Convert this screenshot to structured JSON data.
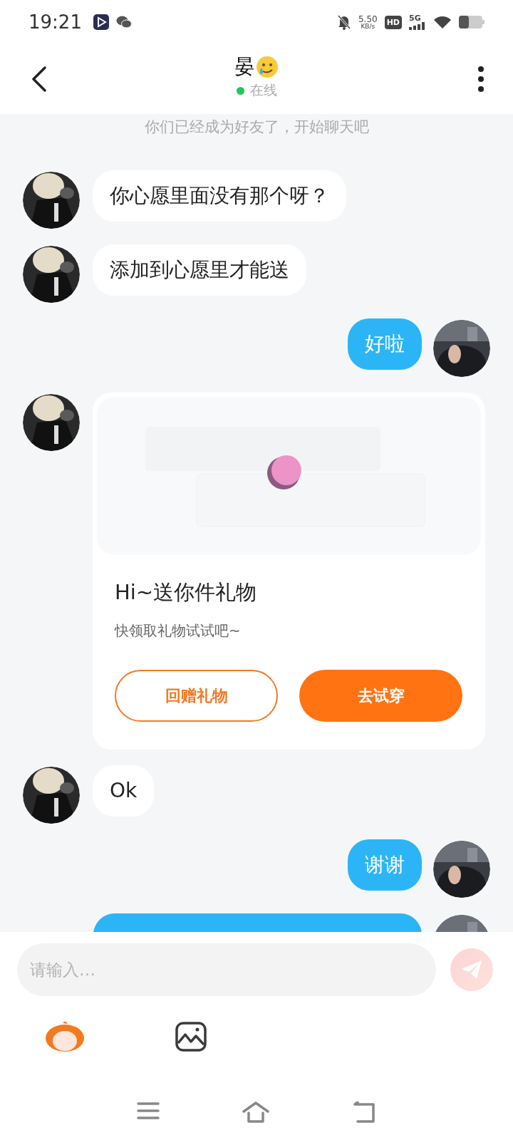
{
  "status_bar": {
    "time": "19:21",
    "net_speed": "5.50",
    "net_unit": "KB/s",
    "hd": "HD",
    "network": "5G"
  },
  "header": {
    "title": "晏",
    "online": true,
    "status": "在线"
  },
  "system_notice": "你们已经成为好友了，开始聊天吧",
  "messages": [
    {
      "kind": "text",
      "mine": false,
      "text": "你心愿里面没有那个呀？"
    },
    {
      "kind": "text",
      "mine": false,
      "text": "添加到心愿里才能送"
    },
    {
      "kind": "text",
      "mine": true,
      "text": "好啦"
    },
    {
      "kind": "gift",
      "mine": false,
      "title": "Hi~送你件礼物",
      "subtitle": "快领取礼物试试吧~",
      "buttons": [
        {
          "kind": "outline",
          "label": "回赠礼物"
        },
        {
          "kind": "filled",
          "label": "去试穿"
        }
      ]
    },
    {
      "kind": "text",
      "mine": false,
      "text": "Ok"
    },
    {
      "kind": "text",
      "mine": true,
      "text": "谢谢"
    },
    {
      "kind": "cut",
      "mine": true
    }
  ],
  "composer": {
    "placeholder": "请输入…"
  }
}
